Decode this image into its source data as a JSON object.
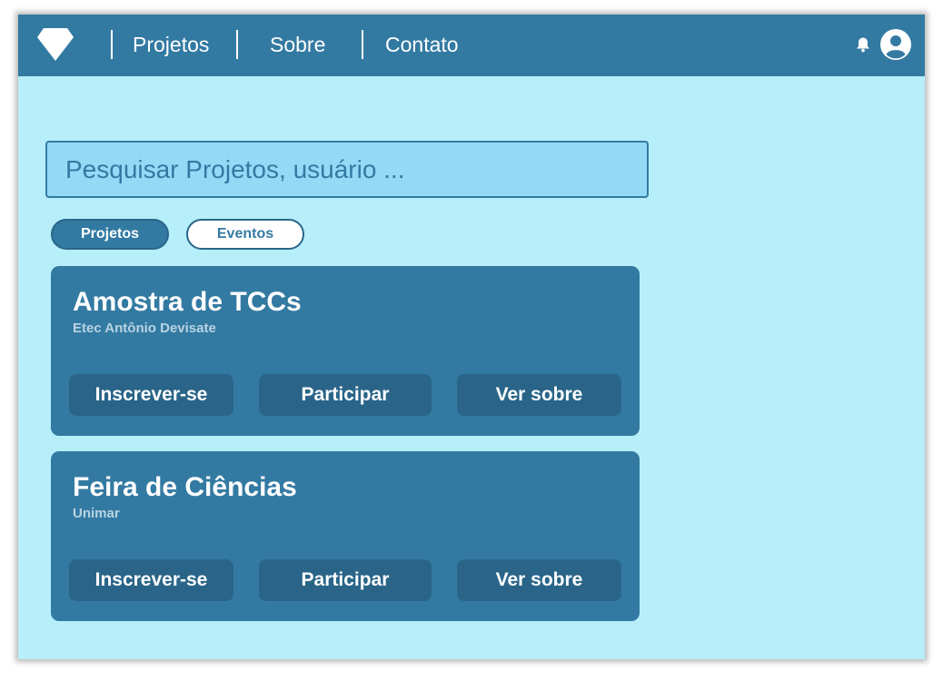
{
  "navbar": {
    "logo_icon": "diamond-icon",
    "links": [
      "Projetos",
      "Sobre",
      "Contato"
    ],
    "bell_icon": "bell-icon",
    "user_icon": "user-icon"
  },
  "search": {
    "placeholder": "Pesquisar Projetos, usuário ..."
  },
  "tabs": [
    {
      "label": "Projetos",
      "active": true
    },
    {
      "label": "Eventos",
      "active": false
    }
  ],
  "cards": [
    {
      "title": "Amostra de TCCs",
      "subtitle": "Etec Antônio Devisate",
      "buttons": [
        "Inscrever-se",
        "Participar",
        "Ver sobre"
      ]
    },
    {
      "title": "Feira de Ciências",
      "subtitle": "Unimar",
      "buttons": [
        "Inscrever-se",
        "Participar",
        "Ver sobre"
      ]
    }
  ],
  "colors": {
    "background": "#b6eef9",
    "navbar": "#337aa2",
    "card": "#337aa2",
    "button": "#2a6589",
    "search_fill": "#93daf6"
  }
}
